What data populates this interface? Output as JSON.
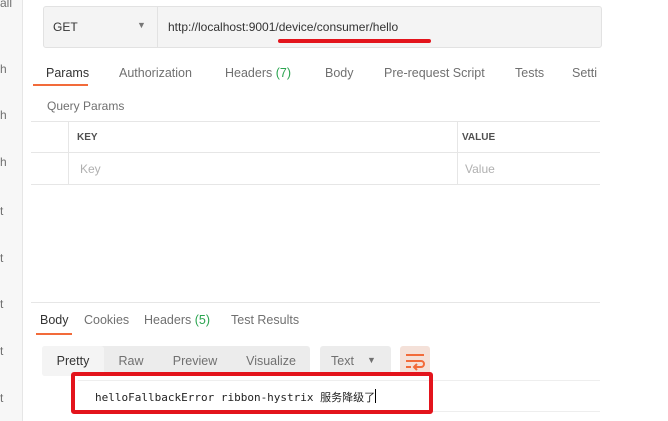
{
  "sidebar": {
    "top_label": "all",
    "items": [
      "h",
      "h",
      "h",
      "t",
      "t",
      "t",
      "t",
      "t"
    ]
  },
  "request": {
    "method": "GET",
    "url": "http://localhost:9001/device/consumer/hello",
    "tabs": [
      {
        "label": "Params"
      },
      {
        "label": "Authorization"
      },
      {
        "label": "Headers ",
        "count": "(7)"
      },
      {
        "label": "Body"
      },
      {
        "label": "Pre-request Script"
      },
      {
        "label": "Tests"
      },
      {
        "label": "Setti"
      }
    ]
  },
  "params": {
    "title": "Query Params",
    "key_header": "KEY",
    "value_header": "VALUE",
    "key_placeholder": "Key",
    "value_placeholder": "Value"
  },
  "response": {
    "tabs": [
      {
        "label": "Body"
      },
      {
        "label": "Cookies"
      },
      {
        "label": "Headers ",
        "count": "(5)"
      },
      {
        "label": "Test Results"
      }
    ],
    "views": [
      "Pretty",
      "Raw",
      "Preview",
      "Visualize"
    ],
    "format": "Text",
    "body_text": "helloFallbackError ribbon-hystrix 服务降级了"
  },
  "colors": {
    "accent": "#f26b3a",
    "highlight_red": "#e3141c",
    "count_green": "#2aa44f"
  }
}
